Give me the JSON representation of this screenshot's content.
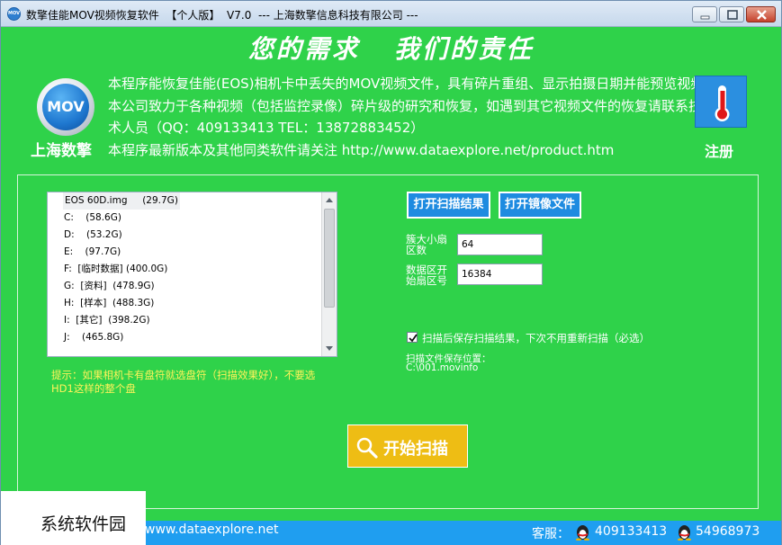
{
  "window": {
    "icon_text": "MOV",
    "title": "数擎佳能MOV视频恢复软件  【个人版】  V7.0  --- 上海数擎信息科技有限公司 ---"
  },
  "header": {
    "slogan": "您的需求   我们的责任",
    "logo_text": "MOV",
    "company": "上海数擎",
    "description": [
      "本程序能恢复佳能(EOS)相机卡中丢失的MOV视频文件，具有碎片重组、显示拍摄日期并能预览视频",
      "本公司致力于各种视频（包括监控录像）碎片级的研究和恢复，如遇到其它视频文件的恢复请联系技",
      "术人员（QQ：409133413  TEL：13872883452）",
      "本程序最新版本及其他同类软件请关注 http://www.dataexplore.net/product.htm"
    ],
    "register_label": "注册",
    "register_icon": "thermometer-icon"
  },
  "drives": [
    {
      "name": "EOS 60D.img",
      "size": "(29.7G)"
    },
    {
      "name": "C:",
      "size": "(58.6G)"
    },
    {
      "name": "D:",
      "size": "(53.2G)"
    },
    {
      "name": "E:",
      "size": "(97.7G)"
    },
    {
      "name": "F:  [临时数据]",
      "size": "(400.0G)"
    },
    {
      "name": "G:  [资料]",
      "size": "(478.9G)"
    },
    {
      "name": "H:  [样本]",
      "size": "(488.3G)"
    },
    {
      "name": "I:  [其它]",
      "size": "(398.2G)"
    },
    {
      "name": "J:",
      "size": "(465.8G)"
    }
  ],
  "hint": "提示：如果相机卡有盘符就选盘符（扫描效果好），不要选HD1这样的整个盘",
  "buttons": {
    "open_result": "打开扫描结果",
    "open_image": "打开镜像文件",
    "start_scan": "开始扫描"
  },
  "fields": {
    "cluster_label": "簇大小扇区数",
    "cluster_value": "64",
    "data_start_label": "数据区开始扇区号",
    "data_start_value": "16384"
  },
  "save_option": {
    "checked": true,
    "label": "扫描后保存扫描结果，下次不用重新扫描（必选）",
    "path_label": "扫描文件保存位置：",
    "path_value": "C:\\001.movinfo"
  },
  "footer": {
    "website": "www.dataexplore.net",
    "service_label": "客服：",
    "qq_numbers": [
      "409133413",
      "54968973"
    ]
  },
  "watermark": "系统软件园",
  "colors": {
    "background": "#2fd24a",
    "button_blue": "#1e8be0",
    "start_button": "#eebd14",
    "hint_yellow": "#fff35a",
    "footer_blue": "#1f9ef0"
  }
}
